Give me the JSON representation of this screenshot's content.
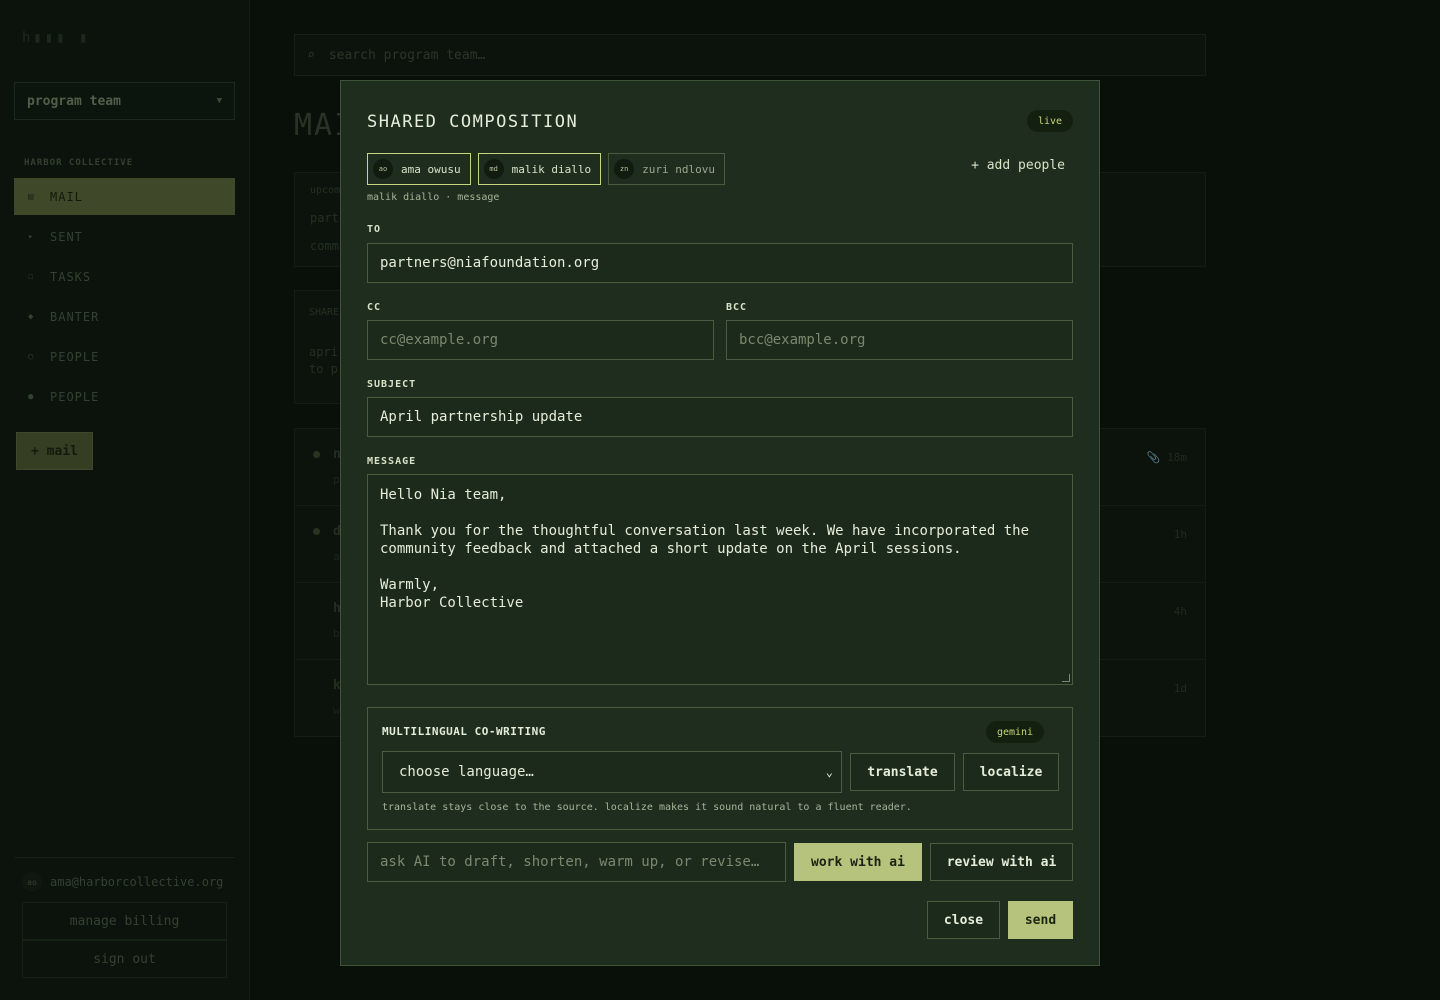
{
  "app": {
    "logo": "h▮▮▮ ▮",
    "team_selector": "program team",
    "org_label": "HARBOR COLLECTIVE"
  },
  "sidebar": {
    "items": [
      {
        "label": "MAIL",
        "icon": "inbox-icon",
        "glyph": "▤"
      },
      {
        "label": "SENT",
        "icon": "send-icon",
        "glyph": "▸"
      },
      {
        "label": "TASKS",
        "icon": "checkbox-icon",
        "glyph": "☐"
      },
      {
        "label": "BANTER",
        "icon": "diamond-icon",
        "glyph": "◆"
      },
      {
        "label": "PEOPLE",
        "icon": "circle-icon",
        "glyph": "○"
      },
      {
        "label": "PEOPLE",
        "icon": "dot-icon",
        "glyph": "●"
      }
    ],
    "new_mail": "+ mail",
    "user_initials": "ao",
    "user_email": "ama@harborcollective.org",
    "manage_billing": "manage billing",
    "sign_out": "sign out"
  },
  "main": {
    "search_placeholder": "search program team…",
    "search_glyph": "⌕",
    "page_title": "MAI",
    "card1": [
      "upcom",
      "part",
      "comm"
    ],
    "card2": [
      "SHARE",
      "apri",
      "to p"
    ],
    "rows": [
      {
        "label": "n",
        "sub": "p",
        "time": "18m",
        "unread": true,
        "attach": true
      },
      {
        "label": "d",
        "sub": "a",
        "time": "1h",
        "unread": true,
        "attach": false
      },
      {
        "label": "h",
        "sub": "b",
        "time": "4h",
        "unread": false,
        "attach": false
      },
      {
        "label": "k",
        "sub": "w",
        "time": "1d",
        "unread": false,
        "attach": false
      }
    ]
  },
  "modal": {
    "title": "SHARED COMPOSITION",
    "live_badge": "live",
    "collaborators": [
      {
        "initials": "ao",
        "name": "ama owusu",
        "state": "on"
      },
      {
        "initials": "md",
        "name": "malik diallo",
        "state": "on"
      },
      {
        "initials": "zn",
        "name": "zuri ndlovu",
        "state": "off"
      }
    ],
    "add_people": "+ add people",
    "status": "malik diallo · message",
    "to_label": "TO",
    "to_value": "partners@niafoundation.org",
    "cc_label": "CC",
    "cc_placeholder": "cc@example.org",
    "bcc_label": "BCC",
    "bcc_placeholder": "bcc@example.org",
    "subject_label": "SUBJECT",
    "subject_value": "April partnership update",
    "message_label": "MESSAGE",
    "message_value": "Hello Nia team,\n\nThank you for the thoughtful conversation last week. We have incorporated the\ncommunity feedback and attached a short update on the April sessions.\n\nWarmly,\nHarbor Collective",
    "multilingual": {
      "title": "MULTILINGUAL CO-WRITING",
      "badge": "gemini",
      "select_value": "choose language…",
      "translate": "translate",
      "localize": "localize",
      "hint": "translate stays close to the source. localize makes it sound natural to a fluent reader."
    },
    "ai_placeholder": "ask AI to draft, shorten, warm up, or revise…",
    "work_with_ai": "work with ai",
    "review_with_ai": "review with ai",
    "close": "close",
    "send": "send"
  },
  "colors": {
    "accent": "#b6c37d",
    "background": "#0b130c",
    "modal": "#1f2d1f",
    "border": "#4b5b3e"
  }
}
